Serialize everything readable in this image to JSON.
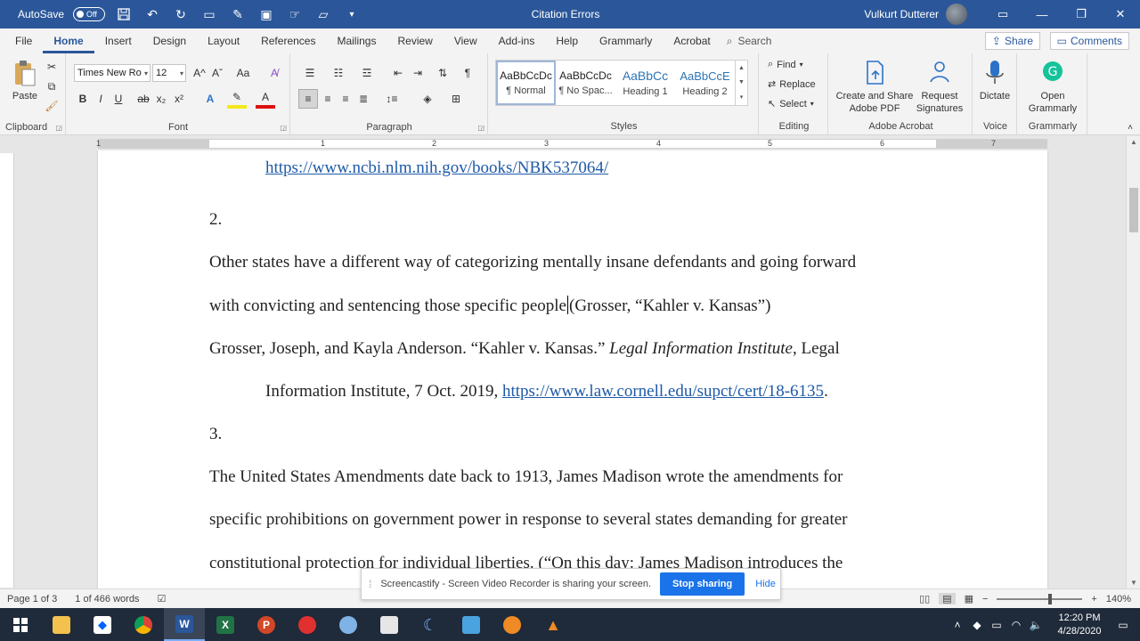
{
  "titlebar": {
    "autosave_label": "AutoSave",
    "autosave_state": "Off",
    "doc_title": "Citation Errors",
    "user_name": "Vulkurt Dutterer",
    "qat_icons": [
      "save-icon",
      "undo-icon",
      "redo-icon",
      "comment-icon",
      "draw-icon",
      "screenshot-icon",
      "touch-icon",
      "open-folder-icon",
      "customize-icon"
    ]
  },
  "tabs": [
    "File",
    "Home",
    "Insert",
    "Design",
    "Layout",
    "References",
    "Mailings",
    "Review",
    "View",
    "Add-ins",
    "Help",
    "Grammarly",
    "Acrobat"
  ],
  "active_tab": "Home",
  "search_label": "Search",
  "share_label": "Share",
  "comments_label": "Comments",
  "ribbon": {
    "clipboard": {
      "label": "Clipboard",
      "paste": "Paste"
    },
    "font": {
      "label": "Font",
      "font_name": "Times New Ro",
      "font_size": "12",
      "bold": "B",
      "italic": "I",
      "underline": "U",
      "strike": "ab",
      "sub": "x₂",
      "sup": "x²",
      "grow": "A^",
      "shrink": "Aˇ",
      "case": "Aa"
    },
    "paragraph": {
      "label": "Paragraph",
      "pilcrow": "¶"
    },
    "styles": {
      "label": "Styles",
      "items": [
        {
          "preview": "AaBbCcDc",
          "name": "¶ Normal"
        },
        {
          "preview": "AaBbCcDc",
          "name": "¶ No Spac..."
        },
        {
          "preview": "AaBbCc",
          "name": "Heading 1"
        },
        {
          "preview": "AaBbCcE",
          "name": "Heading 2"
        }
      ]
    },
    "editing": {
      "label": "Editing",
      "find": "Find",
      "replace": "Replace",
      "select": "Select"
    },
    "adobe": {
      "label": "Adobe Acrobat",
      "create": "Create and Share Adobe PDF",
      "request": "Request Signatures"
    },
    "voice": {
      "label": "Voice",
      "dictate": "Dictate"
    },
    "grammarly": {
      "label": "Grammarly",
      "open": "Open Grammarly"
    }
  },
  "ruler": {
    "numbers": [
      "1",
      "1",
      "2",
      "3",
      "4",
      "5",
      "6",
      "7"
    ]
  },
  "document": {
    "line1_link": "https://www.ncbi.nlm.nih.gov/books/NBK537064/",
    "item2": "2.",
    "para2_line1": "Other states have a different way of categorizing mentally insane defendants and going forward",
    "para2_line2a": "with convicting and sentencing those specific people",
    "para2_line2b": "(Grosser, “Kahler v. Kansas”)",
    "cite_line1a": "Grosser, Joseph, and Kayla Anderson. “Kahler v. Kansas.” ",
    "cite_line1_italic": "Legal Information Institute",
    "cite_line1b": ", Legal",
    "cite_line2a": "Information Institute, 7 Oct. 2019, ",
    "cite_line2_link": "https://www.law.cornell.edu/supct/cert/18-6135",
    "cite_line2b": ".",
    "item3": "3.",
    "para3_line1": "The United States Amendments date back to 1913, James Madison wrote the amendments for",
    "para3_line2": "specific prohibitions on government power in response to several states demanding for greater",
    "para3_line3": "constitutional protection for individual liberties. (“On this day: James Madison introduces the"
  },
  "statusbar": {
    "page": "Page 1 of 3",
    "words": "1 of 466 words",
    "zoom": "140%"
  },
  "sharebar": {
    "message": "Screencastify - Screen Video Recorder is sharing your screen.",
    "stop": "Stop sharing",
    "hide": "Hide"
  },
  "taskbar": {
    "time": "12:20 PM",
    "date": "4/28/2020"
  }
}
